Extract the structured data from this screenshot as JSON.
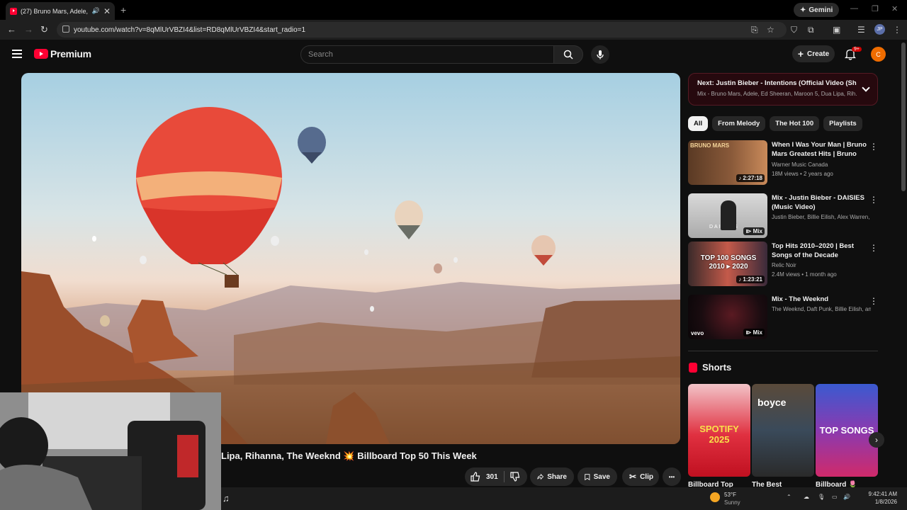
{
  "browser": {
    "tab_title": "(27) Bruno Mars, Adele, Ed",
    "tab_close": "✕",
    "new_tab": "+",
    "gemini_label": "Gemini",
    "url": "youtube.com/watch?v=8qMlUrVBZI4&list=RD8qMlUrVBZI4&start_radio=1",
    "profile_initials": "JP"
  },
  "youtube": {
    "logo_text": "Premium",
    "search_placeholder": "Search",
    "create_label": "Create",
    "notif_badge": "9+",
    "account_initial": "C"
  },
  "video": {
    "title_part1": "Lipa, Rihanna, The Weeknd",
    "title_burst": "💥",
    "title_part2": "Billboard Top 50 This Week",
    "like_count": "301",
    "share_label": "Share",
    "save_label": "Save",
    "clip_label": "Clip",
    "more_label": "•••"
  },
  "up_next": {
    "title": "Next: Justin Bieber - Intentions (Official Video (Shor...",
    "subtitle": "Mix - Bruno Mars, Adele, Ed Sheeran, Maroon 5, Dua Lipa, Rih..."
  },
  "chips": [
    "All",
    "From Melody",
    "The Hot 100",
    "Playlists"
  ],
  "recommendations": [
    {
      "title": "When I Was Your Man | Bruno Mars Greatest Hits | Bruno Ma...",
      "channel": "Warner Music Canada",
      "views": "18M views • 2 years ago",
      "badge": "♪ 2:27:18",
      "thumb_text": "BRUNO MARS"
    },
    {
      "title": "Mix - Justin Bieber - DAISIES (Music Video)",
      "channel": "Justin Bieber, Billie Eilish, Alex Warren, a...",
      "views": "",
      "badge": "⧐ Mix",
      "thumb_text": "DAISIES"
    },
    {
      "title": "Top Hits 2010–2020 | Best Songs of the Decade",
      "channel": "Relic Noir",
      "views": "2.4M views • 1 month ago",
      "badge": "♪ 1:23:21",
      "thumb_text": "TOP 100 SONGS 2010 ▸ 2020"
    },
    {
      "title": "Mix - The Weeknd",
      "channel": "The Weeknd, Daft Punk, Billie Eilish, and ...",
      "views": "",
      "badge": "⧐ Mix",
      "thumb_text": "vevo"
    }
  ],
  "shorts": {
    "heading": "Shorts",
    "items": [
      {
        "label": "Billboard Top",
        "thumb_text": "SPOTIFY 2025"
      },
      {
        "label": "The Best",
        "thumb_text": "boyce"
      },
      {
        "label": "Billboard 🌷",
        "thumb_text": "TOP SONGS"
      }
    ]
  },
  "taskbar": {
    "weather_temp": "53°F",
    "weather_cond": "Sunny",
    "time": "9:42:41 AM",
    "date": "1/8/2026"
  },
  "colors": {
    "accent": "#ff0033",
    "background": "#0f0f0f",
    "next_border": "#551a24"
  }
}
